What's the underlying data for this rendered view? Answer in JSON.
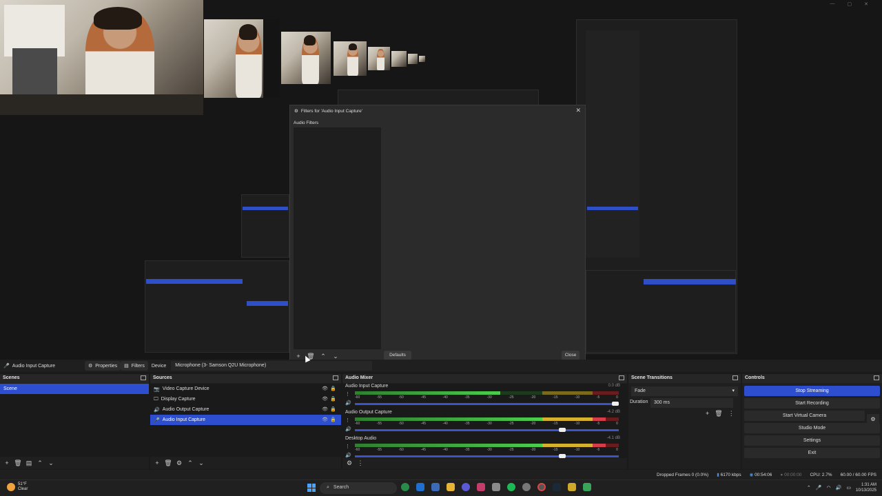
{
  "window": {
    "controls": [
      "—",
      "▢",
      "✕"
    ]
  },
  "filters_dialog": {
    "title": "Filters for 'Audio Input Capture'",
    "section_label": "Audio Filters",
    "defaults_label": "Defaults",
    "close_label": "Close"
  },
  "context_bar": {
    "source_name": "Audio Input Capture",
    "properties_label": "Properties",
    "filters_label": "Filters",
    "device_label": "Device",
    "device_value": "Microphone (3- Samson Q2U Microphone)"
  },
  "scenes": {
    "title": "Scenes",
    "items": [
      {
        "label": "Scene",
        "selected": true
      }
    ]
  },
  "sources": {
    "title": "Sources",
    "items": [
      {
        "label": "Video Capture Device",
        "icon": "camera-icon",
        "selected": false
      },
      {
        "label": "Display Capture",
        "icon": "monitor-icon",
        "selected": false
      },
      {
        "label": "Audio Output Capture",
        "icon": "speaker-icon",
        "selected": false
      },
      {
        "label": "Audio Input Capture",
        "icon": "microphone-icon",
        "selected": true
      }
    ]
  },
  "mixer": {
    "title": "Audio Mixer",
    "scale_labels": [
      "-60",
      "-55",
      "-50",
      "-45",
      "-40",
      "-35",
      "-30",
      "-25",
      "-20",
      "-15",
      "-10",
      "-5",
      "0"
    ],
    "channels": [
      {
        "name": "Audio Input Capture",
        "db": "0.0 dB",
        "level": 0.55,
        "volume": 1.0
      },
      {
        "name": "Audio Output Capture",
        "db": "-4.2 dB",
        "level": 0.95,
        "volume": 0.8
      },
      {
        "name": "Desktop Audio",
        "db": "-4.1 dB",
        "level": 0.95,
        "volume": 0.8
      }
    ]
  },
  "transitions": {
    "title": "Scene Transitions",
    "selected": "Fade",
    "duration_label": "Duration",
    "duration_value": "300 ms"
  },
  "controls": {
    "title": "Controls",
    "buttons": [
      "Stop Streaming",
      "Start Recording",
      "Start Virtual Camera",
      "Studio Mode",
      "Settings",
      "Exit"
    ]
  },
  "status_bar": {
    "dropped_frames": "Dropped Frames 0 (0.0%)",
    "bitrate": "6170 kbps",
    "stream_time": "00:54:06",
    "rec_time": "00:00:00",
    "cpu": "CPU: 2.7%",
    "fps": "60.00 / 60.00 FPS"
  },
  "taskbar": {
    "weather_temp": "51°F",
    "weather_desc": "Clear",
    "search_placeholder": "Search",
    "time": "1:31 AM",
    "date": "10/13/2025"
  },
  "colors": {
    "accent": "#2d4fcf",
    "panel": "#1f1f1f"
  }
}
